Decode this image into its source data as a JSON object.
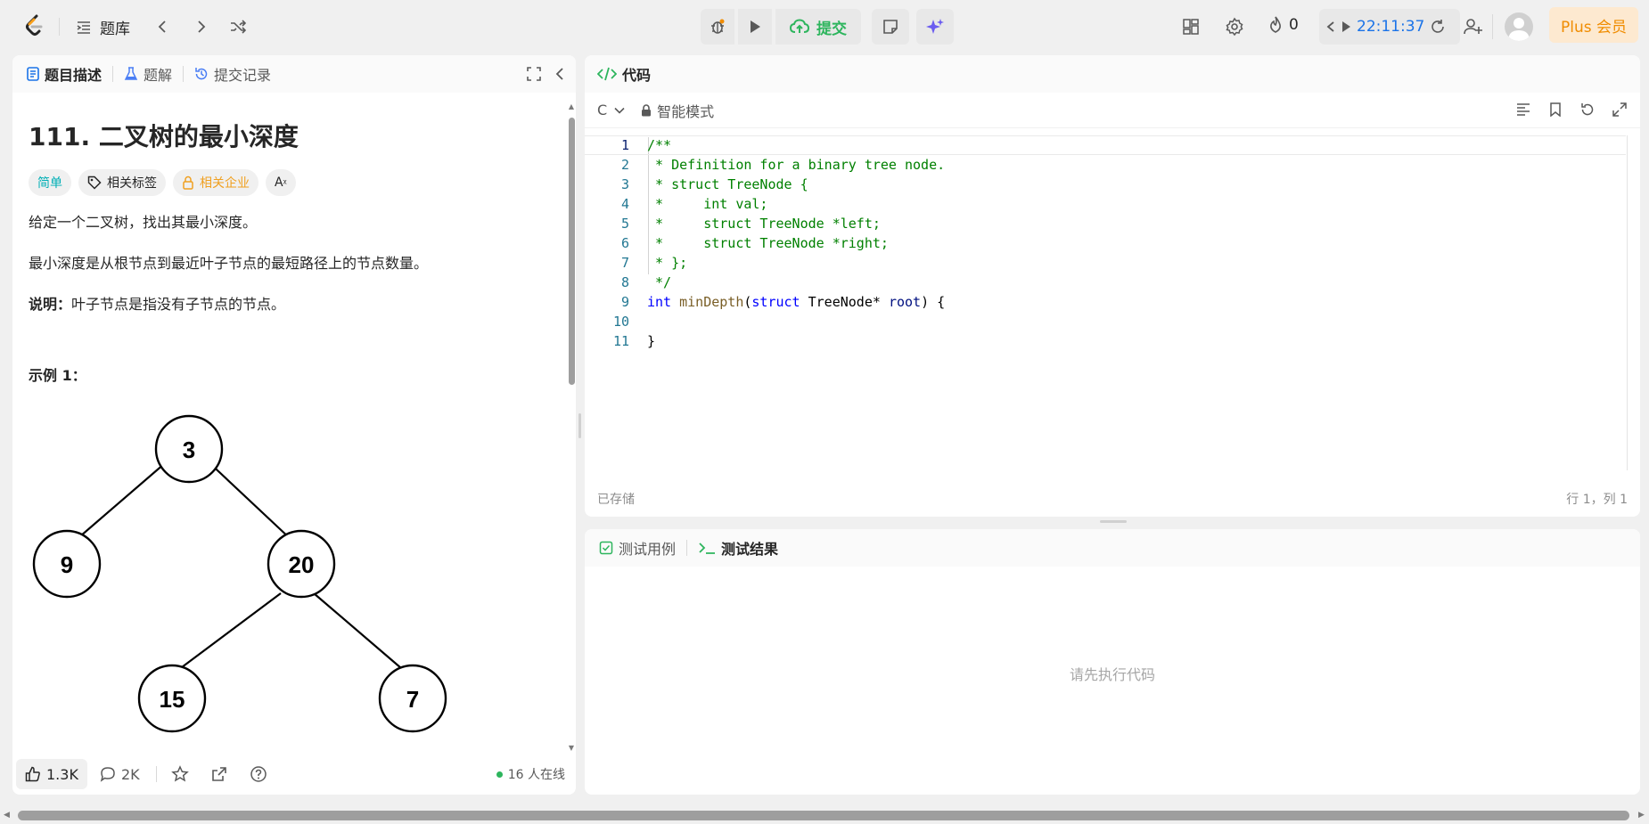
{
  "topbar": {
    "problem_bank_label": "题库",
    "submit_label": "提交",
    "streak_count": "0",
    "timer": "22:11:37",
    "plus_label": "Plus 会员"
  },
  "left_tabs": {
    "description": "题目描述",
    "solutions": "题解",
    "submissions": "提交记录"
  },
  "problem": {
    "title": "111. 二叉树的最小深度",
    "tags": {
      "difficulty": "简单",
      "related_tags": "相关标签",
      "related_companies": "相关企业",
      "translate": "Aあ"
    },
    "para1": "给定一个二叉树，找出其最小深度。",
    "para2": "最小深度是从根节点到最近叶子节点的最短路径上的节点数量。",
    "note_label": "说明：",
    "note_text": "叶子节点是指没有子节点的节点。",
    "example_title": "示例 1：",
    "tree_nodes": [
      "3",
      "9",
      "20",
      "15",
      "7"
    ]
  },
  "left_footer": {
    "likes": "1.3K",
    "comments": "2K",
    "online": "16 人在线"
  },
  "code_panel": {
    "title": "代码",
    "language": "C",
    "mode": "智能模式",
    "saved": "已存储",
    "cursor": "行 1，列 1",
    "lines": [
      "/**",
      " * Definition for a binary tree node.",
      " * struct TreeNode {",
      " *     int val;",
      " *     struct TreeNode *left;",
      " *     struct TreeNode *right;",
      " * };",
      " */",
      "int minDepth(struct TreeNode* root) {",
      "",
      "}"
    ],
    "line_numbers": [
      "1",
      "2",
      "3",
      "4",
      "5",
      "6",
      "7",
      "8",
      "9",
      "10",
      "11"
    ],
    "sig": {
      "kw_int": "int",
      "fn": "minDepth",
      "kw_struct": "struct",
      "type": "TreeNode",
      "star": "*",
      "param": "root",
      "tail": ") {"
    }
  },
  "test_panel": {
    "tab_cases": "测试用例",
    "tab_result": "测试结果",
    "empty_text": "请先执行代码"
  },
  "colors": {
    "accent_green": "#2db55d",
    "easy_cyan": "#00afb6",
    "plus_orange": "#f08c00",
    "timer_blue": "#1a73e8"
  }
}
